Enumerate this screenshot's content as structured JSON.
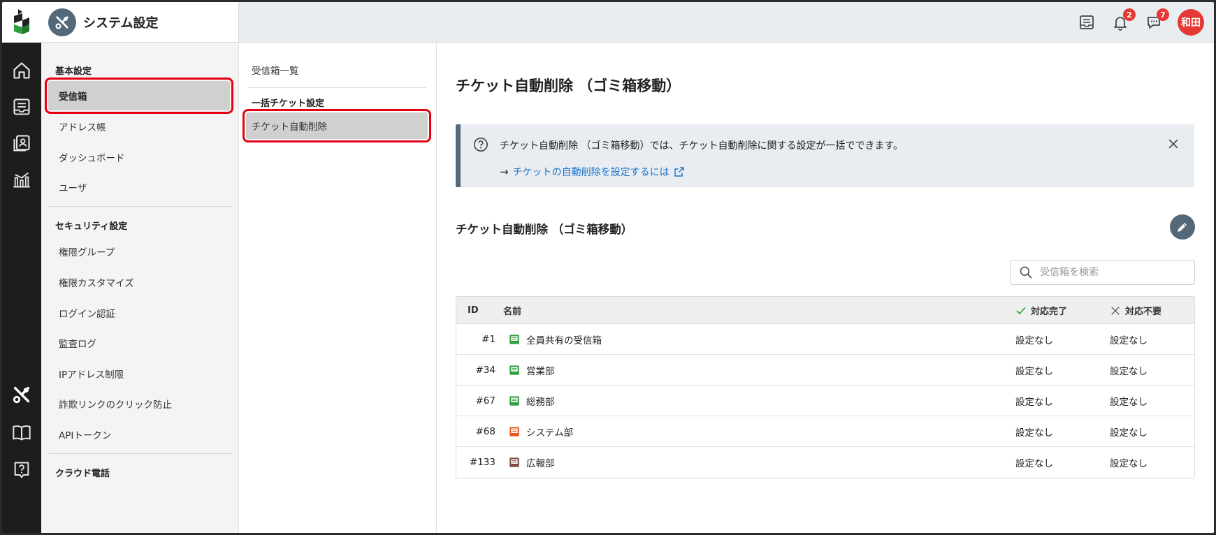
{
  "header": {
    "title": "システム設定",
    "notifications_count": "2",
    "messages_count": "7",
    "avatar_label": "和田"
  },
  "sidebar": {
    "section_basic": "基本設定",
    "basic_items": [
      "受信箱",
      "アドレス帳",
      "ダッシュボード",
      "ユーザ"
    ],
    "section_security": "セキュリティ設定",
    "security_items": [
      "権限グループ",
      "権限カスタマイズ",
      "ログイン認証",
      "監査ログ",
      "IPアドレス制限",
      "詐欺リンクのクリック防止",
      "APIトークン"
    ],
    "section_phone": "クラウド電話"
  },
  "subnav": {
    "inbox_list": "受信箱一覧",
    "section_bulk": "一括チケット設定",
    "active_item": "チケット自動削除"
  },
  "main": {
    "page_title": "チケット自動削除 （ゴミ箱移動）",
    "info_text": "チケット自動削除 （ゴミ箱移動）では、チケット自動削除に関する設定が一括でできます。",
    "info_arrow": "→",
    "info_link": "チケットの自動削除を設定するには",
    "section_title": "チケット自動削除 （ゴミ箱移動）",
    "search_placeholder": "受信箱を検索"
  },
  "table": {
    "headers": {
      "id": "ID",
      "name": "名前",
      "done": "対応完了",
      "unneeded": "対応不要"
    },
    "rows": [
      {
        "id": "#1",
        "name": "全員共有の受信箱",
        "icon_color": "#2e9e3e",
        "done": "設定なし",
        "unneeded": "設定なし"
      },
      {
        "id": "#34",
        "name": "営業部",
        "icon_color": "#2e9e3e",
        "done": "設定なし",
        "unneeded": "設定なし"
      },
      {
        "id": "#67",
        "name": "総務部",
        "icon_color": "#2e9e3e",
        "done": "設定なし",
        "unneeded": "設定なし"
      },
      {
        "id": "#68",
        "name": "システム部",
        "icon_color": "#e8571e",
        "done": "設定なし",
        "unneeded": "設定なし"
      },
      {
        "id": "#133",
        "name": "広報部",
        "icon_color": "#7a4a3a",
        "done": "設定なし",
        "unneeded": "設定なし"
      }
    ]
  },
  "colors": {
    "accent": "#536878",
    "highlight": "#e60012",
    "link": "#1a73c9",
    "badge": "#e53935"
  }
}
